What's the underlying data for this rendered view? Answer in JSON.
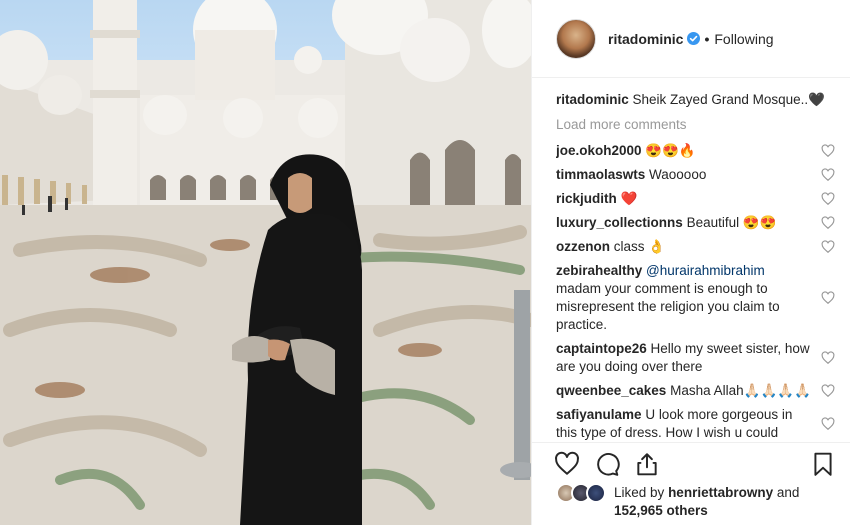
{
  "header": {
    "username": "ritadominic",
    "follow_status": "Following",
    "separator": "•"
  },
  "caption": {
    "username": "ritadominic",
    "text": "Sheik Zayed Grand Mosque..🖤"
  },
  "load_more_label": "Load more comments",
  "comments": [
    {
      "username": "joe.okoh2000",
      "text": "😍😍🔥"
    },
    {
      "username": "timmaolaswts",
      "text": "Waooooo"
    },
    {
      "username": "rickjudith",
      "text": "❤️"
    },
    {
      "username": "luxury_collectionns",
      "text": "Beautiful 😍😍"
    },
    {
      "username": "ozzenon",
      "text": "class 👌"
    },
    {
      "username": "zebirahealthy",
      "mention": "@hurairahmibrahim",
      "text": "madam your comment is enough to misrepresent the religion you claim to practice."
    },
    {
      "username": "captaintope26",
      "text": "Hello my sweet sister, how are you doing over there"
    },
    {
      "username": "qweenbee_cakes",
      "text": "Masha Allah🙏🏻🙏🏻🙏🏻🙏🏻"
    },
    {
      "username": "safiyanulame",
      "text": "U look more gorgeous in this type of dress. How I wish u could"
    }
  ],
  "likes": {
    "prefix": "Liked by",
    "user": "henriettabrowny",
    "connector": "and",
    "count": "152,965 others"
  },
  "icons": [
    "verified-badge-icon",
    "heart-icon",
    "comment-icon",
    "share-icon",
    "bookmark-icon"
  ],
  "colors": {
    "verified": "#3897f0",
    "heart_filled": "#ed4956",
    "mention": "#003569",
    "muted": "#999999"
  }
}
